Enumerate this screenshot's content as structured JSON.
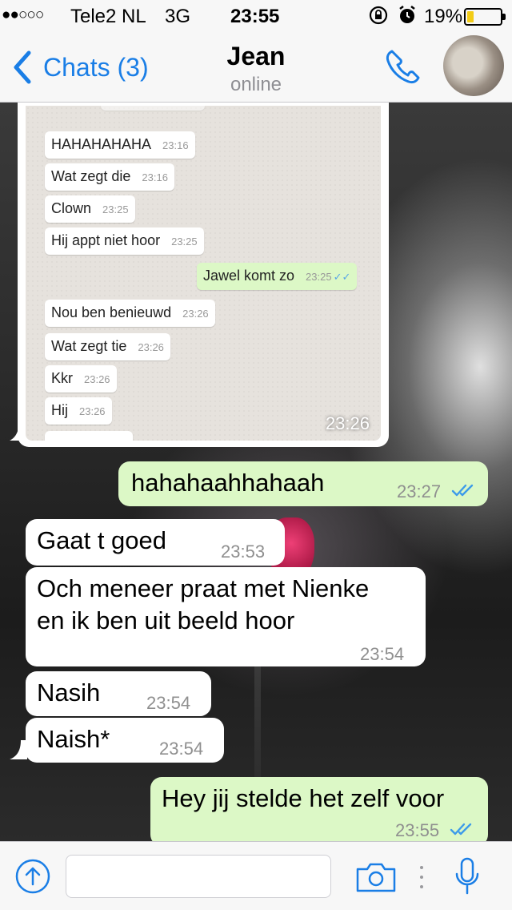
{
  "status_bar": {
    "signal": "●●○○○",
    "carrier": "Tele2 NL",
    "network": "3G",
    "time": "23:55",
    "battery": "19%",
    "battery_level": 0.19
  },
  "nav": {
    "back_label": "Chats (3)",
    "contact_name": "Jean",
    "status": "online"
  },
  "image_message": {
    "time": "23:26",
    "screenshot_messages": [
      {
        "text": "HAHAHAHAHA",
        "time": "23:16",
        "dir": "in"
      },
      {
        "text": "Wat zegt die",
        "time": "23:16",
        "dir": "in"
      },
      {
        "text": "Clown",
        "time": "23:25",
        "dir": "in"
      },
      {
        "text": "Hij appt niet hoor",
        "time": "23:25",
        "dir": "in"
      },
      {
        "text": "Jawel komt zo",
        "time": "23:25",
        "dir": "out"
      },
      {
        "text": "Nou ben benieuwd",
        "time": "23:26",
        "dir": "in"
      },
      {
        "text": "Wat zegt tie",
        "time": "23:26",
        "dir": "in"
      },
      {
        "text": "Kkr",
        "time": "23:26",
        "dir": "in"
      },
      {
        "text": "Hij",
        "time": "23:26",
        "dir": "in"
      }
    ]
  },
  "messages": [
    {
      "text": "hahahaahhahaah",
      "time": "23:27",
      "dir": "out"
    },
    {
      "text": "Gaat t goed",
      "time": "23:53",
      "dir": "in"
    },
    {
      "text": "Och meneer praat met Nienke",
      "text2": "en ik ben uit beeld hoor",
      "time": "23:54",
      "dir": "in"
    },
    {
      "text": "Nasih",
      "time": "23:54",
      "dir": "in"
    },
    {
      "text": "Naish*",
      "time": "23:54",
      "dir": "in"
    },
    {
      "text": "Hey jij stelde het zelf voor",
      "time": "23:55",
      "dir": "out"
    }
  ],
  "input": {
    "value": "",
    "placeholder": ""
  },
  "colors": {
    "accent": "#1a7ee6",
    "outgoing_bubble": "#dcf8c6",
    "incoming_bubble": "#ffffff",
    "read_ticks": "#3d9be9"
  },
  "icons": [
    "chevron-left-icon",
    "phone-icon",
    "upload-arrow-icon",
    "camera-icon",
    "mic-icon",
    "double-check-icon"
  ]
}
